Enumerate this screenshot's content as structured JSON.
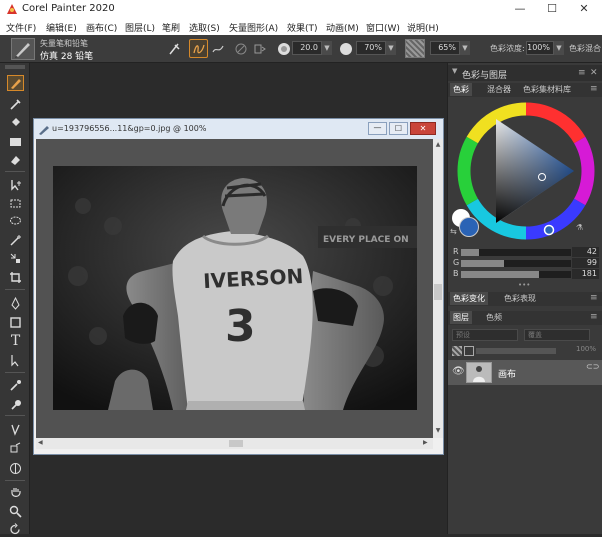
{
  "app": {
    "title": "Corel Painter 2020"
  },
  "window_controls": {
    "minimize": "—",
    "maximize": "☐",
    "close": "✕"
  },
  "menu": [
    "文件(F)",
    "编辑(E)",
    "画布(C)",
    "图层(L)",
    "笔刷",
    "选取(S)",
    "矢量图形(A)",
    "效果(T)",
    "动画(M)",
    "窗口(W)",
    "说明(H)"
  ],
  "property_bar": {
    "brush_category": "矢量笔和铅笔",
    "brush_variant": "仿真 28 铅笔",
    "size_value": "20.0",
    "opacity_value": "70%",
    "grain_value": "65%",
    "color_concentration_label": "色彩浓度:",
    "color_concentration_value": "100%",
    "color_blend_label": "色彩混合"
  },
  "document": {
    "title": "u=193796556...11&gp=0.jpg @ 100%",
    "photo": {
      "jersey_name": "IVERSON",
      "jersey_number": "3",
      "banner_text": "EVERY PLACE ON"
    }
  },
  "panels": {
    "color_panel_title": "色彩与图层",
    "color_tabs": [
      "色彩",
      "混合器",
      "色彩集材料库"
    ],
    "rgb": {
      "r_label": "R",
      "r_value": "42",
      "g_label": "G",
      "g_value": "99",
      "b_label": "B",
      "b_value": "181"
    },
    "dots": "•••",
    "sub_tabs": [
      "色彩变化",
      "色彩表现"
    ],
    "layer_tabs": [
      "图层",
      "色频"
    ],
    "layer_blend_mode": "预设",
    "layer_composite": "覆盖",
    "layer_opacity": "100%",
    "layer_item_name": "画布"
  },
  "colors": {
    "main_color": "#2a63b5",
    "hue_selector": "#2a63b5"
  }
}
